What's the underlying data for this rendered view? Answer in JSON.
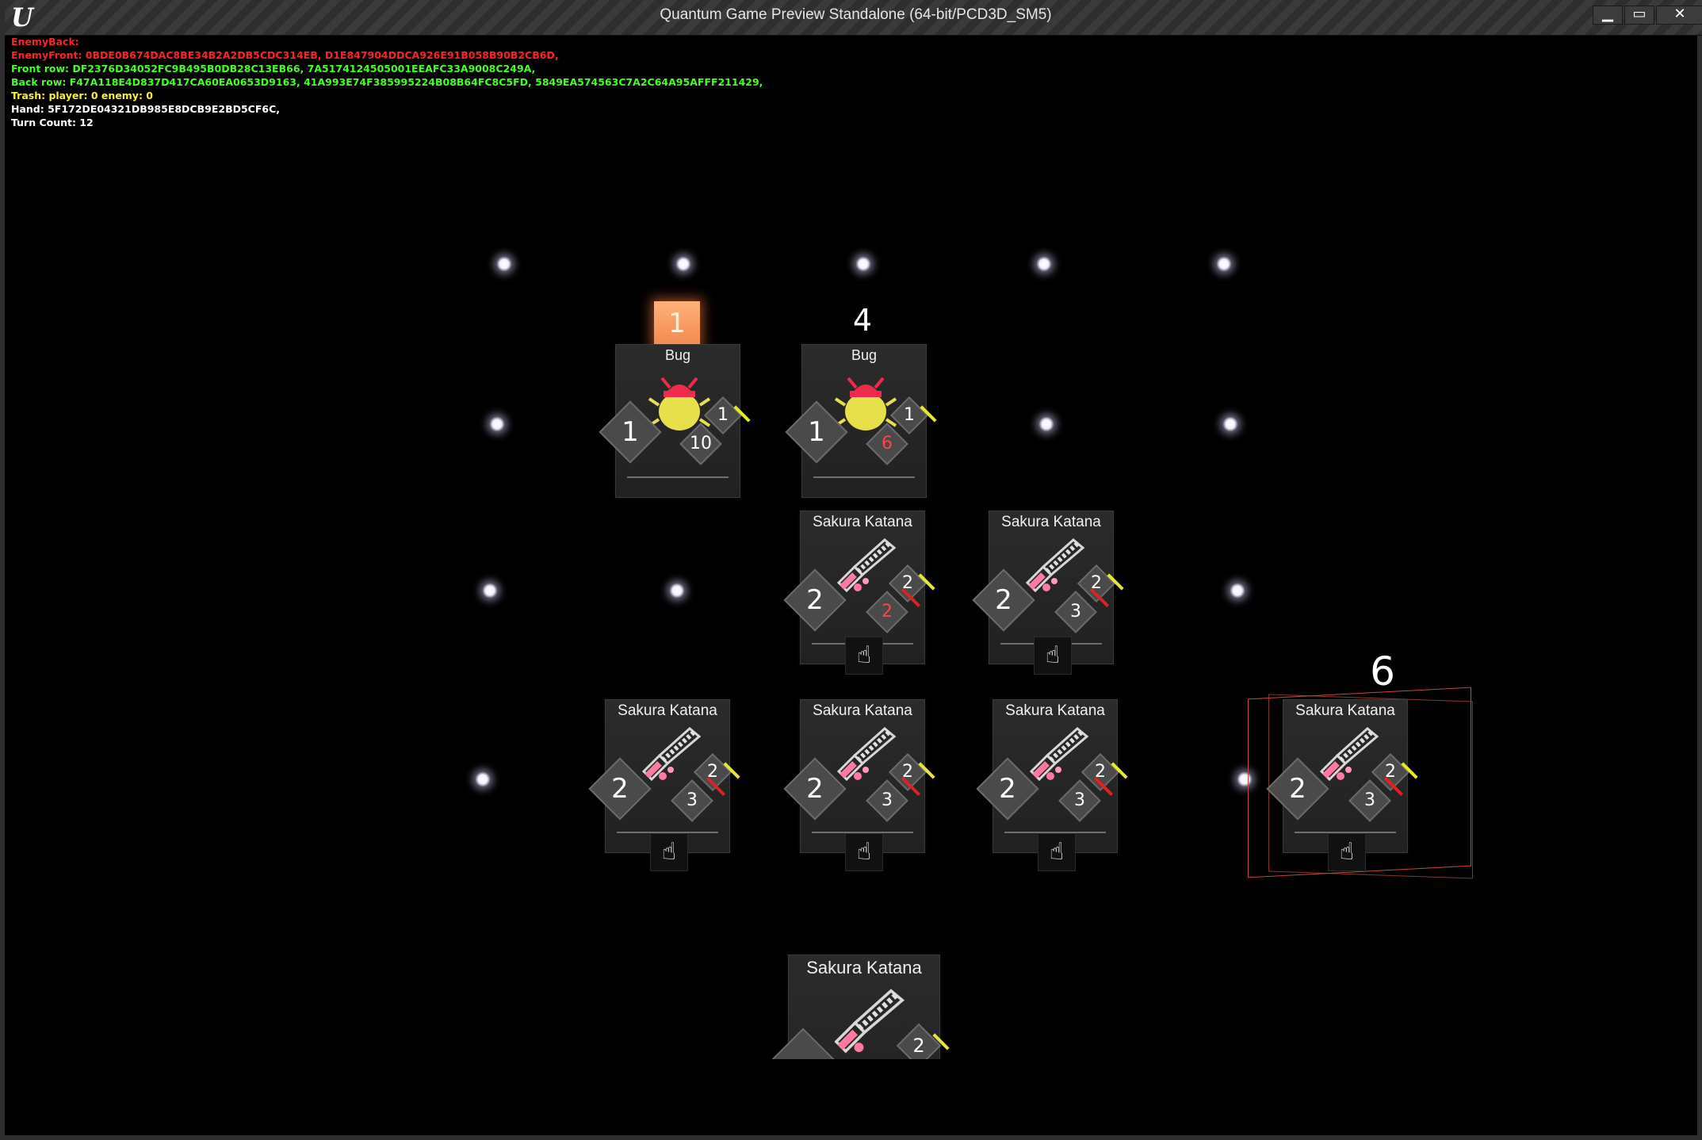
{
  "window": {
    "title": "Quantum Game Preview Standalone (64-bit/PCD3D_SM5)",
    "logo": "U",
    "minimize": "▁",
    "maximize": "▭",
    "close": "✕"
  },
  "debug": {
    "enemy_back": "EnemyBack:",
    "enemy_front": "EnemyFront: 0BDE0B674DAC8BE34B2A2DB5CDC314EB, D1E847904DDCA926E91B058B90B2CB6D,",
    "front_row": "Front row: DF2376D34052FC9B495B0DB28C13EB66, 7A5174124505001EEAFC33A9008C249A,",
    "back_row": "Back row: F47A118E4D837D417CA60EA0653D9163, 41A993E74F385995224B08B64FC8C5FD, 5849EA574563C7A2C64A95AFFF211429,",
    "trash": "Trash: player: 0   enemy: 0",
    "hand": "Hand: 5F172DE04321DB985E8DCB9E2BD5CF6C,",
    "turn_count": "Turn Count: 12"
  },
  "board": {
    "bug1_badge": "1",
    "bug2_above": "4",
    "selected_above": "6"
  },
  "cards": {
    "bug1": {
      "name": "Bug",
      "left": "1",
      "top": "1",
      "bottom": "10"
    },
    "bug2": {
      "name": "Bug",
      "left": "1",
      "top": "1",
      "bottom": "6"
    },
    "front1": {
      "name": "Sakura Katana",
      "left": "2",
      "top": "2",
      "bottom": "2"
    },
    "front2": {
      "name": "Sakura Katana",
      "left": "2",
      "top": "2",
      "bottom": "3"
    },
    "back1": {
      "name": "Sakura Katana",
      "left": "2",
      "top": "2",
      "bottom": "3"
    },
    "back2": {
      "name": "Sakura Katana",
      "left": "2",
      "top": "2",
      "bottom": "3"
    },
    "back3": {
      "name": "Sakura Katana",
      "left": "2",
      "top": "2",
      "bottom": "3"
    },
    "selected": {
      "name": "Sakura Katana",
      "left": "2",
      "top": "2",
      "bottom": "3"
    },
    "hand": {
      "name": "Sakura Katana",
      "top": "2"
    }
  },
  "icons": {
    "hand_pointer": "☝",
    "bug": "bug-icon",
    "katana": "katana-icon"
  },
  "colors": {
    "enemy_text": "#ff2222",
    "player_text": "#44ff22",
    "trash_text": "#ffee33",
    "damaged_value": "#ff4444",
    "badge": "#f38a50"
  }
}
